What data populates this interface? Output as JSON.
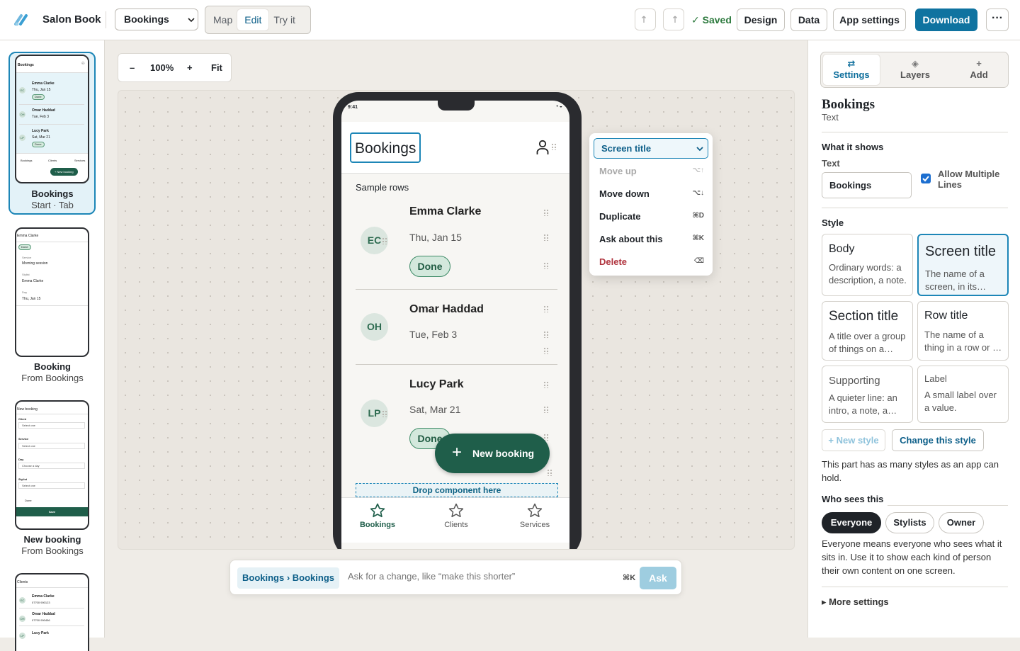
{
  "app": {
    "name": "Salon Book"
  },
  "toolbar": {
    "screen_select": "Bookings",
    "modes": [
      "Map",
      "Edit",
      "Try it"
    ],
    "active_mode": "Edit",
    "undo_icon": "undo-icon",
    "redo_icon": "redo-icon",
    "saved": "✓ Saved",
    "design": "Design",
    "data": "Data",
    "app_settings": "App settings",
    "download": "Download",
    "more": "···"
  },
  "screens": [
    {
      "name": "Bookings",
      "sub": "Start · Tab"
    },
    {
      "name": "Booking",
      "sub": "From Bookings"
    },
    {
      "name": "New booking",
      "sub": "From Bookings"
    },
    {
      "name": "Clients",
      "sub": ""
    }
  ],
  "thumbs": {
    "bookings": {
      "title": "Bookings",
      "rows": [
        {
          "initials": "EC",
          "name": "Emma Clarke",
          "date": "Thu, Jan 15",
          "status": "Done"
        },
        {
          "initials": "OH",
          "name": "Omar Haddad",
          "date": "Tue, Feb 3",
          "status": ""
        },
        {
          "initials": "LP",
          "name": "Lucy Park",
          "date": "Sat, Mar 21",
          "status": "Done"
        }
      ],
      "tabs": [
        "Bookings",
        "Clients",
        "Services"
      ],
      "fab": "+ New booking"
    },
    "booking": {
      "title": "Emma Clarke",
      "status": "Done",
      "f1l": "Service",
      "f1v": "Morning session",
      "f2l": "Stylist",
      "f2v": "Emma Clarke",
      "f3l": "Day",
      "f3v": "Thu, Jan 15"
    },
    "new_booking": {
      "title": "New booking",
      "f1l": "Client",
      "f1v": "Select one",
      "f2l": "Service",
      "f2v": "Select one",
      "f3l": "Day",
      "f3v": "Choose a day",
      "f4l": "Stylist",
      "f4v": "Select one",
      "done": "Done",
      "save": "Save"
    },
    "clients": {
      "title": "Clients",
      "rows": [
        {
          "initials": "EC",
          "name": "Emma Clarke",
          "phone": "07700 900123"
        },
        {
          "initials": "OH",
          "name": "Omar Haddad",
          "phone": "07700 900456"
        },
        {
          "initials": "LP",
          "name": "Lucy Park",
          "phone": ""
        }
      ]
    }
  },
  "zoom": {
    "minus": "–",
    "level": "100%",
    "plus": "+",
    "fit": "Fit"
  },
  "phone": {
    "time": "9:41",
    "status": "• ◒",
    "title": "Bookings",
    "sample": "Sample rows",
    "rows": [
      {
        "initials": "EC",
        "name": "Emma Clarke",
        "date": "Thu, Jan 15",
        "status": "Done"
      },
      {
        "initials": "OH",
        "name": "Omar Haddad",
        "date": "Tue, Feb 3",
        "status": ""
      },
      {
        "initials": "LP",
        "name": "Lucy Park",
        "date": "Sat, Mar 21",
        "status": "Done"
      }
    ],
    "fab": "New booking",
    "drop": "Drop component here",
    "tabs": [
      {
        "label": "Bookings",
        "icon": "star-icon"
      },
      {
        "label": "Clients",
        "icon": "star-icon"
      },
      {
        "label": "Services",
        "icon": "star-icon"
      }
    ]
  },
  "context_menu": {
    "select": "Screen title",
    "items": [
      {
        "label": "Move up",
        "key": "⌥↑"
      },
      {
        "label": "Move down",
        "key": "⌥↓"
      },
      {
        "label": "Duplicate",
        "key": "⌘D"
      },
      {
        "label": "Ask about this",
        "key": "⌘K"
      },
      {
        "label": "Delete",
        "key": "⌫"
      }
    ]
  },
  "ask": {
    "crumb": "Bookings › Bookings",
    "placeholder": "Ask for a change, like “make this shorter”",
    "kbd": "⌘K",
    "button": "Ask"
  },
  "inspector": {
    "tabs": [
      {
        "label": "Settings",
        "icon": "sliders-icon"
      },
      {
        "label": "Layers",
        "icon": "layers-icon"
      },
      {
        "label": "Add",
        "icon": "plus-icon"
      }
    ],
    "title": "Bookings",
    "kind": "Text",
    "what_heading": "What it shows",
    "text_label": "Text",
    "text_value": "Bookings",
    "multiline": "Allow Multiple Lines",
    "style_heading": "Style",
    "styles": [
      {
        "name": "Body",
        "desc": "Ordinary words: a description, a note."
      },
      {
        "name": "Screen title",
        "desc": "The name of a screen, in its…"
      },
      {
        "name": "Section title",
        "desc": "A title over a group of things on a…"
      },
      {
        "name": "Row title",
        "desc": "The name of a thing in a row or …"
      },
      {
        "name": "Supporting",
        "desc": "A quieter line: an intro, a note, a…"
      },
      {
        "name": "Label",
        "desc": "A small label over a value."
      }
    ],
    "new_style": "+ New style",
    "change_style": "Change this style",
    "style_note": "This part has as many styles as an app can hold.",
    "who_heading": "Who sees this",
    "audiences": [
      "Everyone",
      "Stylists",
      "Owner"
    ],
    "who_note": "Everyone means everyone who sees what it sits in. Use it to show each kind of person their own content on one screen.",
    "more_settings": "▸ More settings"
  },
  "colors": {
    "accent": "#0f73a0",
    "selection": "#1d86b7",
    "brand_green": "#1f5e4a",
    "danger": "#b0343e",
    "saved": "#2d7a3e"
  }
}
